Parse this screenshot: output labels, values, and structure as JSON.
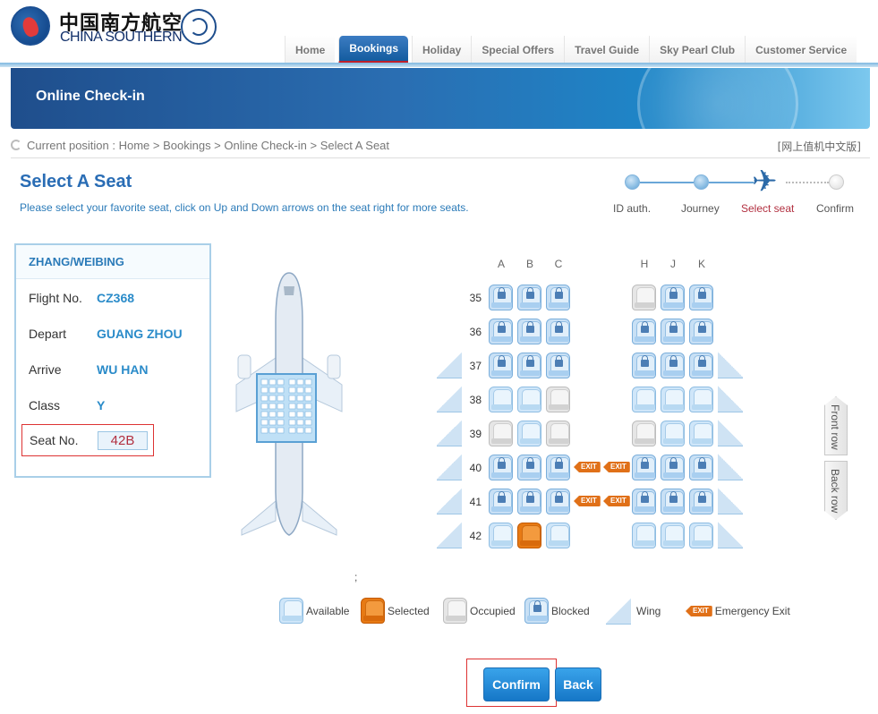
{
  "brand": {
    "name_cn": "中国南方航空",
    "name_en": "CHINA SOUTHERN",
    "alliance": "SKYTEAM"
  },
  "nav": [
    "Home",
    "Bookings",
    "Holiday",
    "Special Offers",
    "Travel Guide",
    "Sky Pearl Club",
    "Customer Service"
  ],
  "nav_active": "Bookings",
  "banner_title": "Online Check-in",
  "breadcrumb": {
    "text": "Current position : Home > Bookings > Online Check-in > Select A Seat",
    "cn_link": "[网上值机中文版]"
  },
  "page": {
    "title": "Select A Seat",
    "hint": "Please select your favorite seat, click on Up and Down arrows on the seat right for more seats."
  },
  "progress": {
    "steps": [
      "ID auth.",
      "Journey",
      "Select seat",
      "Confirm"
    ],
    "current": 2
  },
  "passenger": {
    "name": "ZHANG/WEIBING",
    "fields": [
      {
        "label": "Flight No.",
        "value": "CZ368"
      },
      {
        "label": "Depart",
        "value": "GUANG ZHOU"
      },
      {
        "label": "Arrive",
        "value": "WU HAN"
      },
      {
        "label": "Class",
        "value": "Y"
      }
    ],
    "seat_label": "Seat No.",
    "seat_value": "42B"
  },
  "seatmap": {
    "columns": [
      "A",
      "B",
      "C",
      "H",
      "J",
      "K"
    ],
    "rows": [
      {
        "num": "35",
        "wing": false,
        "exit": false,
        "seats": [
          "blocked",
          "blocked",
          "blocked",
          "occupied",
          "blocked",
          "blocked"
        ]
      },
      {
        "num": "36",
        "wing": false,
        "exit": false,
        "seats": [
          "blocked",
          "blocked",
          "blocked",
          "blocked",
          "blocked",
          "blocked"
        ]
      },
      {
        "num": "37",
        "wing": true,
        "exit": false,
        "seats": [
          "blocked",
          "blocked",
          "blocked",
          "blocked",
          "blocked",
          "blocked"
        ]
      },
      {
        "num": "38",
        "wing": true,
        "exit": false,
        "seats": [
          "available",
          "available",
          "occupied",
          "available",
          "available",
          "available"
        ]
      },
      {
        "num": "39",
        "wing": true,
        "exit": false,
        "seats": [
          "occupied",
          "available",
          "occupied",
          "occupied",
          "available",
          "available"
        ]
      },
      {
        "num": "40",
        "wing": true,
        "exit": true,
        "seats": [
          "blocked",
          "blocked",
          "blocked",
          "blocked",
          "blocked",
          "blocked"
        ]
      },
      {
        "num": "41",
        "wing": true,
        "exit": true,
        "seats": [
          "blocked",
          "blocked",
          "blocked",
          "blocked",
          "blocked",
          "blocked"
        ]
      },
      {
        "num": "42",
        "wing": true,
        "exit": false,
        "seats": [
          "available",
          "selected",
          "available",
          "available",
          "available",
          "available"
        ]
      }
    ],
    "exit_label": "EXIT",
    "front_row": "Front row",
    "back_row": "Back row"
  },
  "stray_text": ";",
  "legend": [
    {
      "type": "available",
      "label": "Available"
    },
    {
      "type": "selected",
      "label": "Selected"
    },
    {
      "type": "occupied",
      "label": "Occupied"
    },
    {
      "type": "blocked",
      "label": "Blocked"
    },
    {
      "type": "wing",
      "label": "Wing"
    },
    {
      "type": "exit",
      "label": "Emergency Exit"
    }
  ],
  "buttons": {
    "confirm": "Confirm",
    "back": "Back"
  },
  "colors": {
    "brand_blue": "#2a6db5",
    "selected_orange": "#e77a14",
    "active_tab_underline": "#c0202b"
  }
}
